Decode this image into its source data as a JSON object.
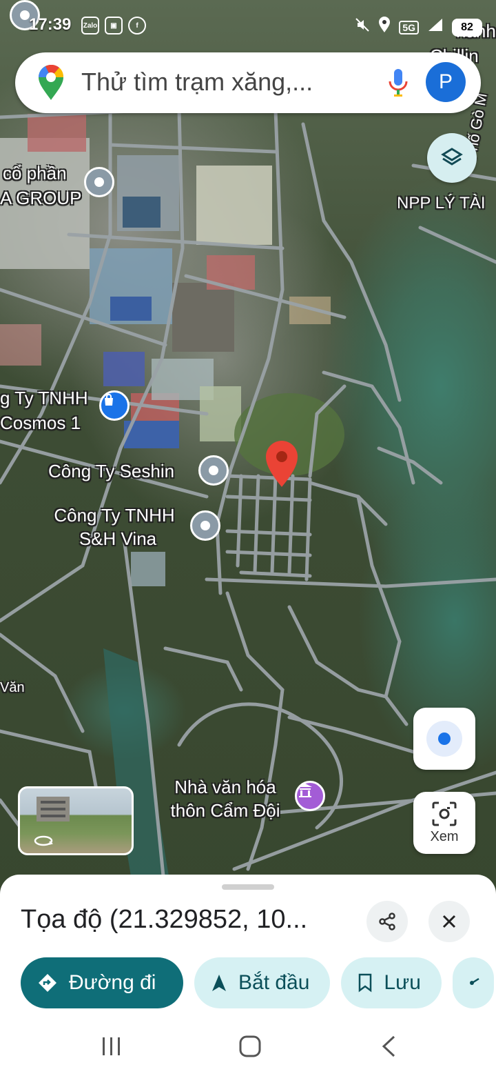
{
  "status_bar": {
    "time": "17:39",
    "zalo_label": "Zalo",
    "network": "5G",
    "battery": "82"
  },
  "search": {
    "placeholder": "Thử tìm trạm xăng,...",
    "avatar_letter": "P"
  },
  "map_labels": {
    "top_right_fragment": "hành",
    "top_right_fragment2": "- Chillin",
    "road_vertical": "Phố Gò M",
    "npp": "NPP LÝ TÀI",
    "company_1_line1": "cổ phần",
    "company_1_line2": "A GROUP",
    "cosmos_line1": "g Ty TNHH",
    "cosmos_line2": "Cosmos 1",
    "seshin": "Công Ty Seshin",
    "shvina_line1": "Công Ty TNHH",
    "shvina_line2": "S&H Vina",
    "van_fragment": "Văn",
    "culture_line1": "Nhà văn hóa",
    "culture_line2": "thôn Cẩm Đội"
  },
  "controls": {
    "lens_label": "Xem"
  },
  "sheet": {
    "title": "Tọa độ (21.329852, 10...",
    "chips": {
      "directions": "Đường đi",
      "start": "Bắt đầu",
      "save": "Lưu"
    }
  },
  "colors": {
    "primary_chip": "#0f6e78",
    "secondary_chip": "#d6f1f3",
    "pin_red": "#ea4335",
    "accent_blue": "#1a73e8"
  }
}
